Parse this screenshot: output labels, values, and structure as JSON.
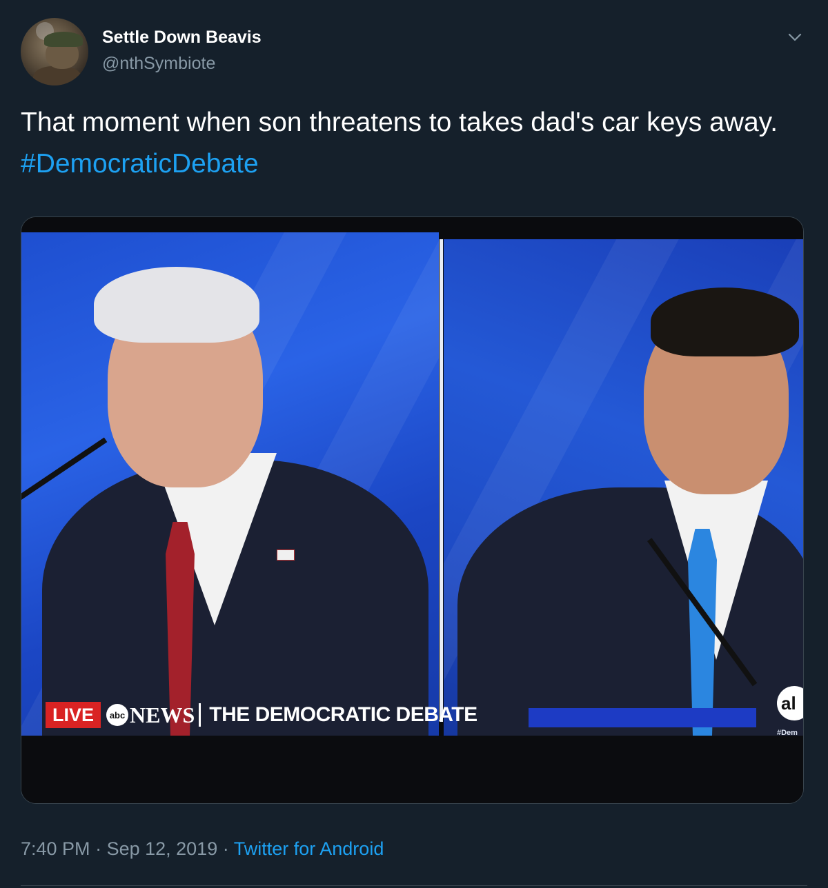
{
  "author": {
    "display_name": "Settle Down Beavis",
    "handle": "@nthSymbiote",
    "avatar_icon": "avatar-icon"
  },
  "menu": {
    "icon": "chevron-down-icon"
  },
  "tweet": {
    "text": "That moment when son threatens to takes dad's car keys away. ",
    "hashtag": "#DemocraticDebate"
  },
  "media": {
    "chyron_live": "LIVE",
    "chyron_abc": "abc",
    "chyron_news": "NEWS",
    "chyron_title": "THE DEMOCRATIC DEBATE",
    "corner_logo": "al",
    "corner_tag": "#Dem"
  },
  "meta": {
    "time": "7:40 PM",
    "separator": " · ",
    "date": "Sep 12, 2019",
    "source": "Twitter for Android"
  },
  "colors": {
    "background": "#15202b",
    "link": "#1da1f2",
    "secondary_text": "#8899a6",
    "live_red": "#d92323"
  }
}
